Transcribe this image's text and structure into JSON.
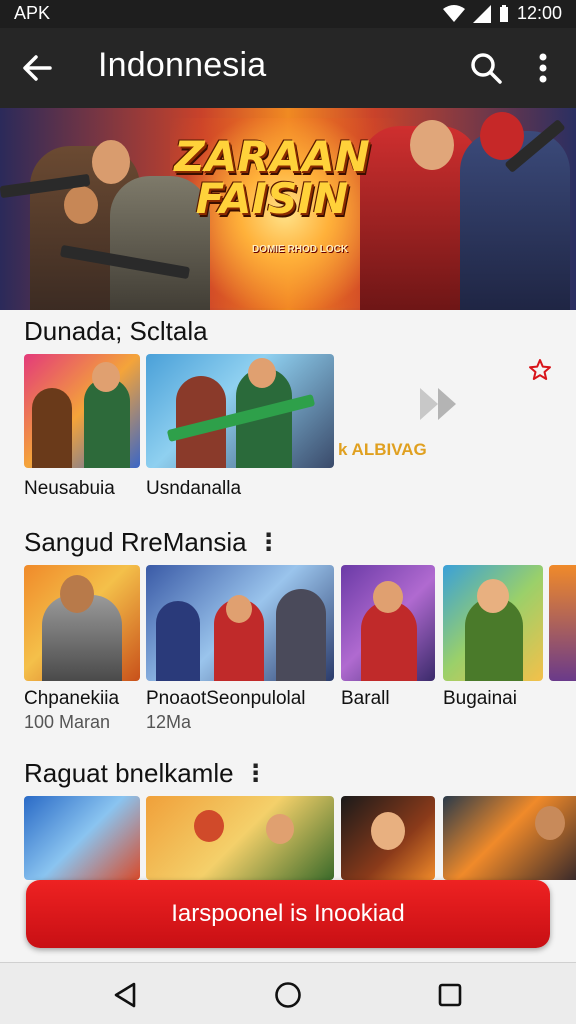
{
  "status_bar": {
    "left_text": "APK",
    "time": "12:00"
  },
  "app_bar": {
    "title": "Indonnesia",
    "back_icon": "arrow-left-icon",
    "search_icon": "search-icon",
    "more_icon": "more-vertical-icon"
  },
  "hero": {
    "title_line1": "ZARAAN",
    "title_line2": "FAISIN",
    "subtitle": "DOMIE RHOD LOCK"
  },
  "sections": [
    {
      "title": "Dunada; Scltala",
      "cards": [
        {
          "label": "Neusabuia"
        },
        {
          "label": "Usndanalla"
        }
      ],
      "promo_text": "k ALBIVAG",
      "star_icon": "star-outline-icon",
      "arrow_icon": "double-chevron-right-icon"
    },
    {
      "title": "Sangud RreMansia",
      "cards": [
        {
          "label": "Chpanekiia",
          "sub": "100 Maran"
        },
        {
          "label": "PnoaotSeonpulolal",
          "sub": "12Ma"
        },
        {
          "label": "Barall"
        },
        {
          "label": "Bugainai"
        }
      ]
    },
    {
      "title": "Raguat bnelkamle"
    }
  ],
  "install_button": {
    "label": "Iarspoonel is Inookiad"
  },
  "nav_bar": {
    "back": "back-triangle-icon",
    "home": "home-circle-icon",
    "recents": "recents-square-icon"
  },
  "colors": {
    "accent_red": "#d8141a",
    "app_bar": "#262626"
  }
}
